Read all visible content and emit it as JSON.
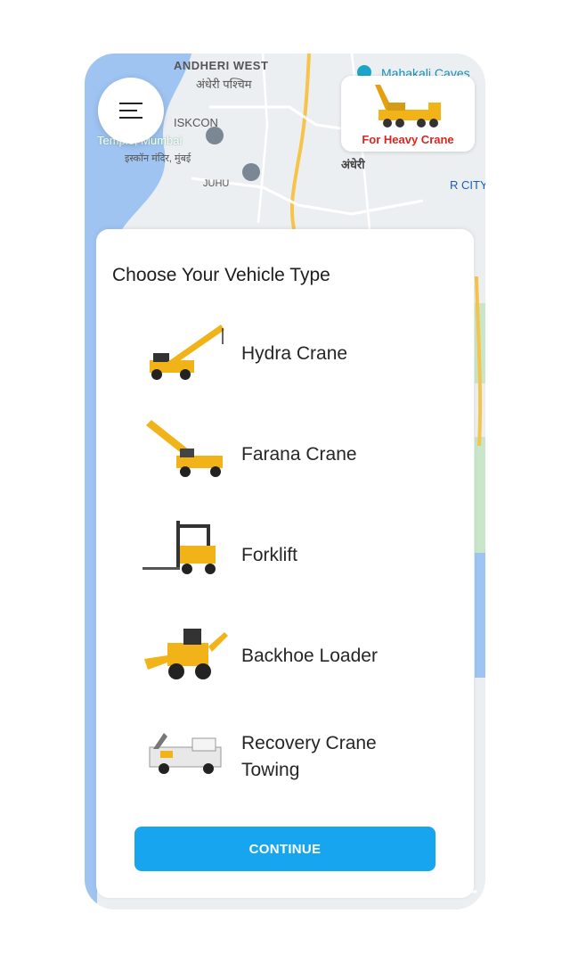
{
  "map": {
    "labels": {
      "andheri_west": "ANDHERI WEST",
      "andheri_west_hi": "अंधेरी पश्चिम",
      "mahakali": "Mahakali Caves",
      "iskcon": "ISKCON",
      "temple": "Temple, Mumbai",
      "temple_hi": "इस्कॉन मंदिर, मुंबई",
      "juhu": "JUHU",
      "andheri_hi": "अंधेरी",
      "city": "R CITY"
    }
  },
  "promo": {
    "label": "For Heavy Crane"
  },
  "sheet": {
    "title": "Choose Your Vehicle Type",
    "vehicles": [
      {
        "name": "Hydra Crane",
        "icon": "hydra-crane-icon"
      },
      {
        "name": "Farana Crane",
        "icon": "farana-crane-icon"
      },
      {
        "name": "Forklift",
        "icon": "forklift-icon"
      },
      {
        "name": "Backhoe Loader",
        "icon": "backhoe-loader-icon"
      },
      {
        "name": "Recovery Crane Towing",
        "icon": "tow-truck-icon"
      }
    ],
    "continue_label": "CONTINUE"
  },
  "colors": {
    "accent": "#17a5ef",
    "promo_text": "#e0241e",
    "crane_yellow": "#f2b319"
  }
}
